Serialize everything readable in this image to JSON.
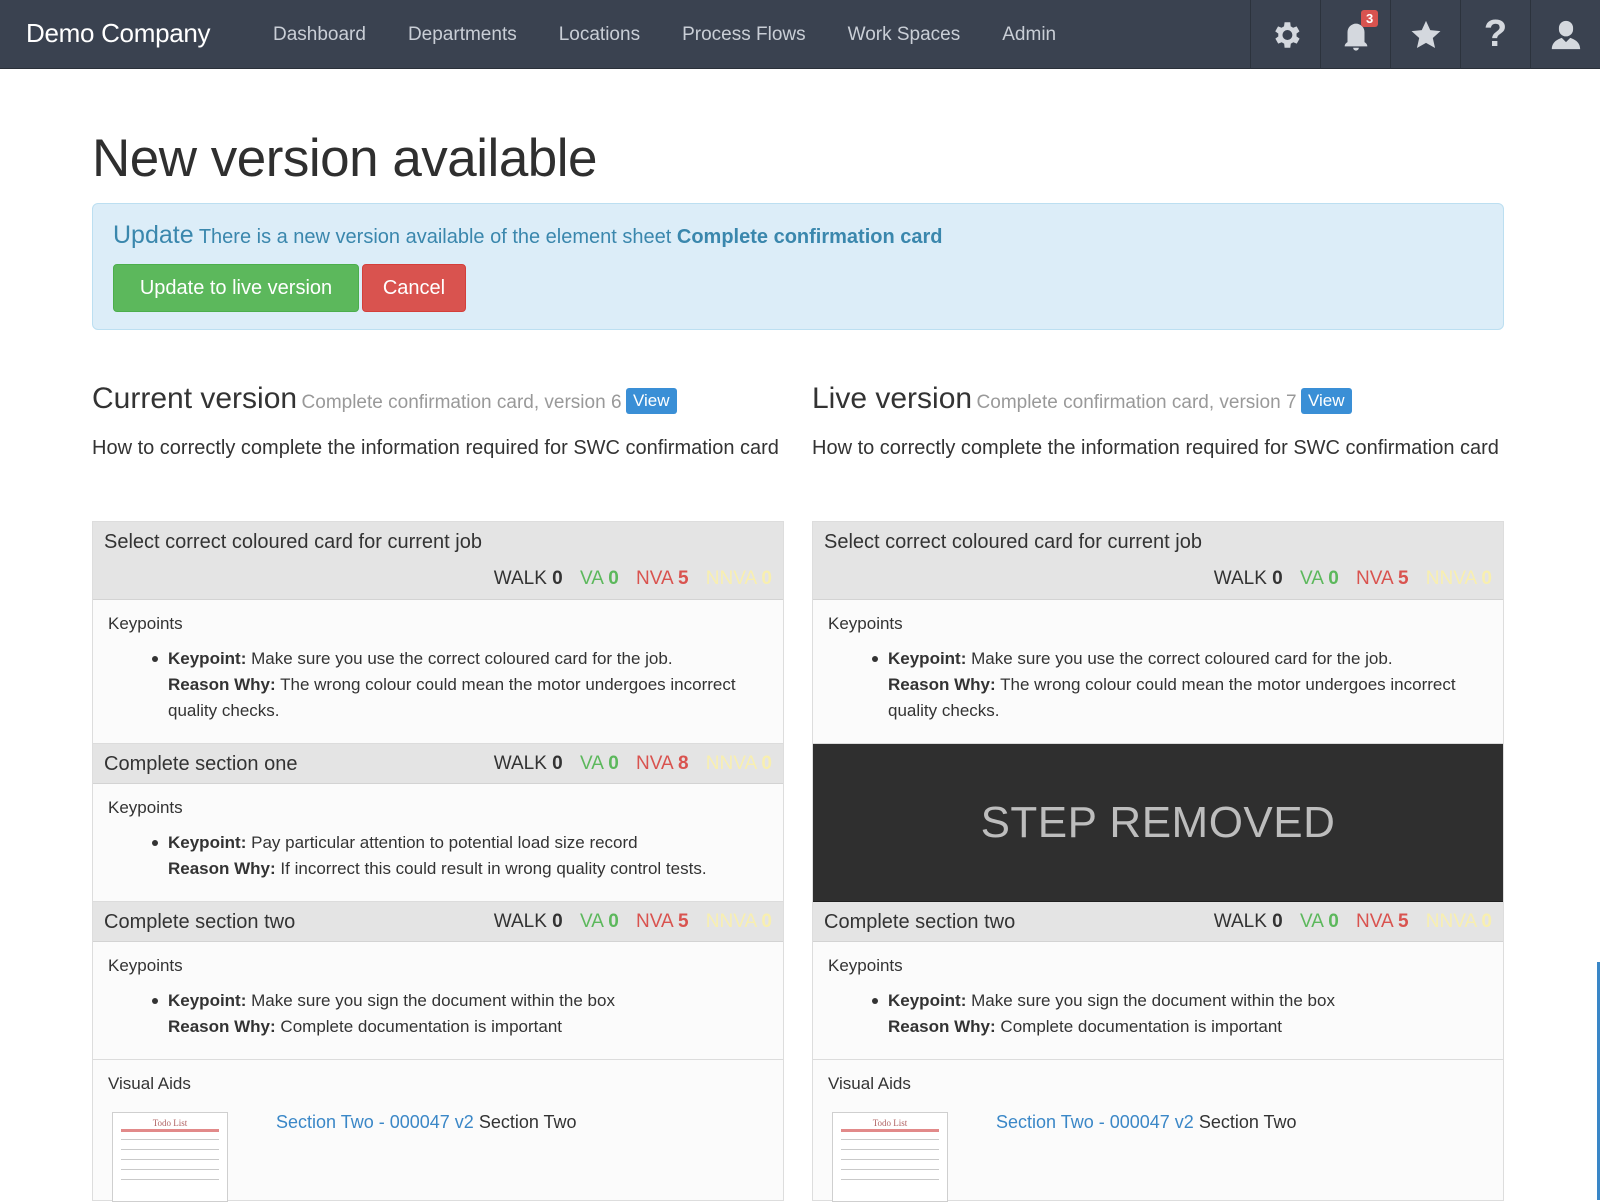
{
  "navbar": {
    "brand": "Demo Company",
    "links": [
      "Dashboard",
      "Departments",
      "Locations",
      "Process Flows",
      "Work Spaces",
      "Admin"
    ],
    "icons": [
      "gear-icon",
      "notifications-icon",
      "star-icon",
      "help-icon",
      "user-icon"
    ],
    "notification_count": "3",
    "help_glyph": "?"
  },
  "page": {
    "title": "New version available"
  },
  "alert": {
    "strong": "Update",
    "text": "There is a new version available of the element sheet",
    "sheet_name": "Complete confirmation card",
    "update_button": "Update to live version",
    "cancel_button": "Cancel"
  },
  "metric_labels": {
    "walk": "WALK",
    "va": "VA",
    "nva": "NVA",
    "nnva": "NNVA"
  },
  "labels": {
    "keypoints": "Keypoints",
    "keypoint": "Keypoint:",
    "reason_why": "Reason Why:",
    "visual_aids": "Visual Aids",
    "step_removed": "STEP REMOVED",
    "view": "View"
  },
  "current": {
    "heading": "Current version",
    "subtitle": "Complete confirmation card, version 6",
    "description": "How to correctly complete the information required for SWC confirmation card",
    "steps": [
      {
        "title": "Select correct coloured card for current job",
        "walk": "0",
        "va": "0",
        "nva": "5",
        "nnva": "0",
        "keypoint": "Make sure you use the correct coloured card for the job.",
        "reason": "The wrong colour could mean the motor undergoes incorrect quality checks."
      },
      {
        "title": "Complete section one",
        "walk": "0",
        "va": "0",
        "nva": "8",
        "nnva": "0",
        "keypoint": "Pay particular attention to potential load size record",
        "reason": "If incorrect this could result in wrong quality control tests."
      },
      {
        "title": "Complete section two",
        "walk": "0",
        "va": "0",
        "nva": "5",
        "nnva": "0",
        "keypoint": "Make sure you sign the document within the box",
        "reason": "Complete documentation is important"
      }
    ],
    "visual_aid": {
      "link": "Section Two - 000047 v2",
      "name": "Section Two",
      "thumb_title": "Todo List"
    }
  },
  "live": {
    "heading": "Live version",
    "subtitle": "Complete confirmation card, version 7",
    "description": "How to correctly complete the information required for SWC confirmation card",
    "steps": [
      {
        "title": "Select correct coloured card for current job",
        "walk": "0",
        "va": "0",
        "nva": "5",
        "nnva": "0",
        "keypoint": "Make sure you use the correct coloured card for the job.",
        "reason": "The wrong colour could mean the motor undergoes incorrect quality checks."
      },
      {
        "removed": true
      },
      {
        "title": "Complete section two",
        "walk": "0",
        "va": "0",
        "nva": "5",
        "nnva": "0",
        "keypoint": "Make sure you sign the document within the box",
        "reason": "Complete documentation is important"
      }
    ],
    "visual_aid": {
      "link": "Section Two - 000047 v2",
      "name": "Section Two",
      "thumb_title": "Todo List"
    }
  },
  "colors": {
    "navbar": "#3a4250",
    "alert_bg": "#dcedf8",
    "success": "#5cb85c",
    "danger": "#d9534f",
    "va": "#5cb85c",
    "nva": "#d9534f",
    "nnva": "#f8efb0",
    "link": "#3a87c7"
  }
}
